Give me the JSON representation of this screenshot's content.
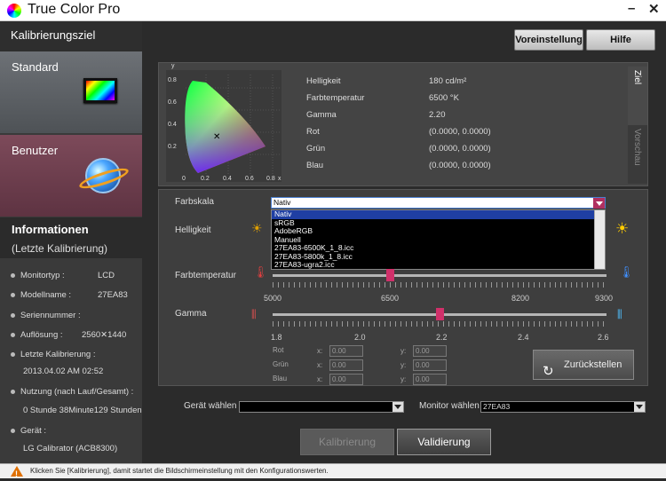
{
  "app": {
    "title": "True Color Pro",
    "minimize": "–",
    "close": "✕"
  },
  "sidebar": {
    "header": "Kalibrierungsziel",
    "modes": [
      {
        "label": "Standard"
      },
      {
        "label": "Benutzer"
      }
    ],
    "info": {
      "title": "Informationen",
      "subtitle": "(Letzte Kalibrierung)"
    },
    "items": [
      {
        "label": "Monitortyp :",
        "value": "LCD"
      },
      {
        "label": "Modellname :",
        "value": "27EA83"
      },
      {
        "label": "Seriennummer :",
        "value": ""
      },
      {
        "label": "Auflösung :",
        "value": "2560✕1440"
      },
      {
        "label": "Letzte Kalibrierung :",
        "value": "2013.04.02  AM 02:52"
      },
      {
        "label": "Nutzung (nach Lauf/Gesamt) :",
        "value": "0 Stunde 38Minute129 Stunden"
      },
      {
        "label": "Gerät :",
        "value": "LG Calibrator (ACB8300)"
      }
    ]
  },
  "toolbar": {
    "preset_label": "Voreinstellung",
    "help_label": "Hilfe"
  },
  "target": {
    "rows": [
      {
        "label": "Helligkeit",
        "value": "180 cd/m²"
      },
      {
        "label": "Farbtemperatur",
        "value": "6500 °K"
      },
      {
        "label": "Gamma",
        "value": "2.20"
      },
      {
        "label": "Rot",
        "value": "(0.0000, 0.0000)"
      },
      {
        "label": "Grün",
        "value": "(0.0000, 0.0000)"
      },
      {
        "label": "Blau",
        "value": "(0.0000, 0.0000)"
      }
    ],
    "tab_target": "Ziel",
    "tab_preview": "Vorschau",
    "cie_y_ticks": [
      "0.8",
      "0.6",
      "0.4",
      "0.2"
    ],
    "cie_x_ticks": [
      "0",
      "0.2",
      "0.4",
      "0.6",
      "0.8"
    ],
    "cie_y_label": "y",
    "cie_x_label": "x"
  },
  "controls": {
    "gamut_label": "Farbskala",
    "gamut_value": "Nativ",
    "gamut_options": [
      "Nativ",
      "sRGB",
      "AdobeRGB",
      "Manuell",
      "27EA83-6500K_1_8.icc",
      "27EA83-5800k_1_8.icc",
      "27EA83-ugra2.icc"
    ],
    "brightness_label": "Helligkeit",
    "temp_label": "Farbtemperatur",
    "temp_ticks": [
      "5000",
      "6500",
      "8200",
      "9300"
    ],
    "temp_value": 6500,
    "temp_range": [
      5000,
      9300
    ],
    "gamma_label": "Gamma",
    "gamma_ticks": [
      "1.8",
      "2.0",
      "2.2",
      "2.4",
      "2.6"
    ],
    "gamma_value": 2.2,
    "gamma_range": [
      1.8,
      2.6
    ],
    "manual": [
      {
        "label": "Rot",
        "x": "0.00",
        "y": "0.00"
      },
      {
        "label": "Grün",
        "x": "0.00",
        "y": "0.00"
      },
      {
        "label": "Blau",
        "x": "0.00",
        "y": "0.00"
      }
    ],
    "x_label": "x:",
    "y_label": "y:",
    "reset_label": "Zurückstellen"
  },
  "device": {
    "device_label": "Gerät wählen",
    "device_value": "",
    "monitor_label": "Monitor wählen",
    "monitor_value": "27EA83"
  },
  "actions": {
    "calibrate_label": "Kalibrierung",
    "validate_label": "Validierung"
  },
  "status": {
    "text": "Klicken Sie [Kalibrierung], damit startet die Bildschirmeinstellung mit den Konfigurationswerten."
  },
  "colors": {
    "accent": "#d0306a",
    "user_panel": "#6b3c4c"
  }
}
